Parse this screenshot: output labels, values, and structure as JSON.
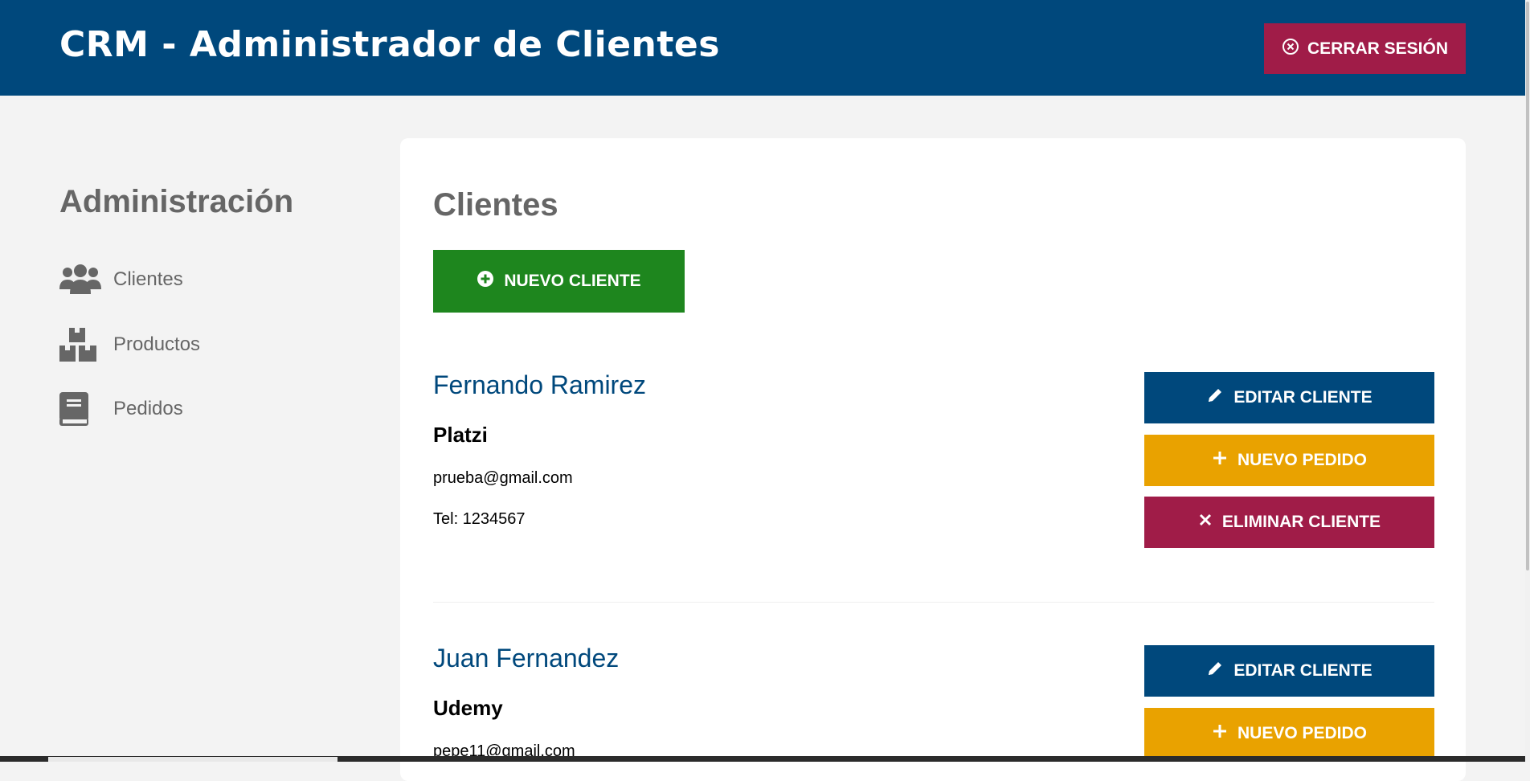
{
  "header": {
    "title": "CRM - Administrador de Clientes",
    "logout_label": "Cerrar Sesión",
    "logout_icon": "circle-x-icon"
  },
  "sidebar": {
    "title": "Administración",
    "items": [
      {
        "label": "Clientes",
        "icon": "users-icon"
      },
      {
        "label": "Productos",
        "icon": "boxes-icon"
      },
      {
        "label": "Pedidos",
        "icon": "book-icon"
      }
    ]
  },
  "main": {
    "title": "Clientes",
    "new_client_label": "Nuevo Cliente",
    "clients": [
      {
        "name": "Fernando Ramirez",
        "company": "Platzi",
        "email": "prueba@gmail.com",
        "phone": "Tel: 1234567",
        "edit_label": "Editar Cliente",
        "order_label": "Nuevo Pedido",
        "delete_label": "Eliminar Cliente"
      },
      {
        "name": "Juan Fernandez",
        "company": "Udemy",
        "email": "pepe11@gmail.com",
        "edit_label": "Editar Cliente",
        "order_label": "Nuevo Pedido"
      }
    ]
  },
  "colors": {
    "header": "#00487c",
    "primary": "#00487c",
    "success": "#1e861e",
    "warning": "#e9a200",
    "danger": "#a01c48",
    "muted_text": "#666666",
    "background": "#f3f3f3"
  }
}
